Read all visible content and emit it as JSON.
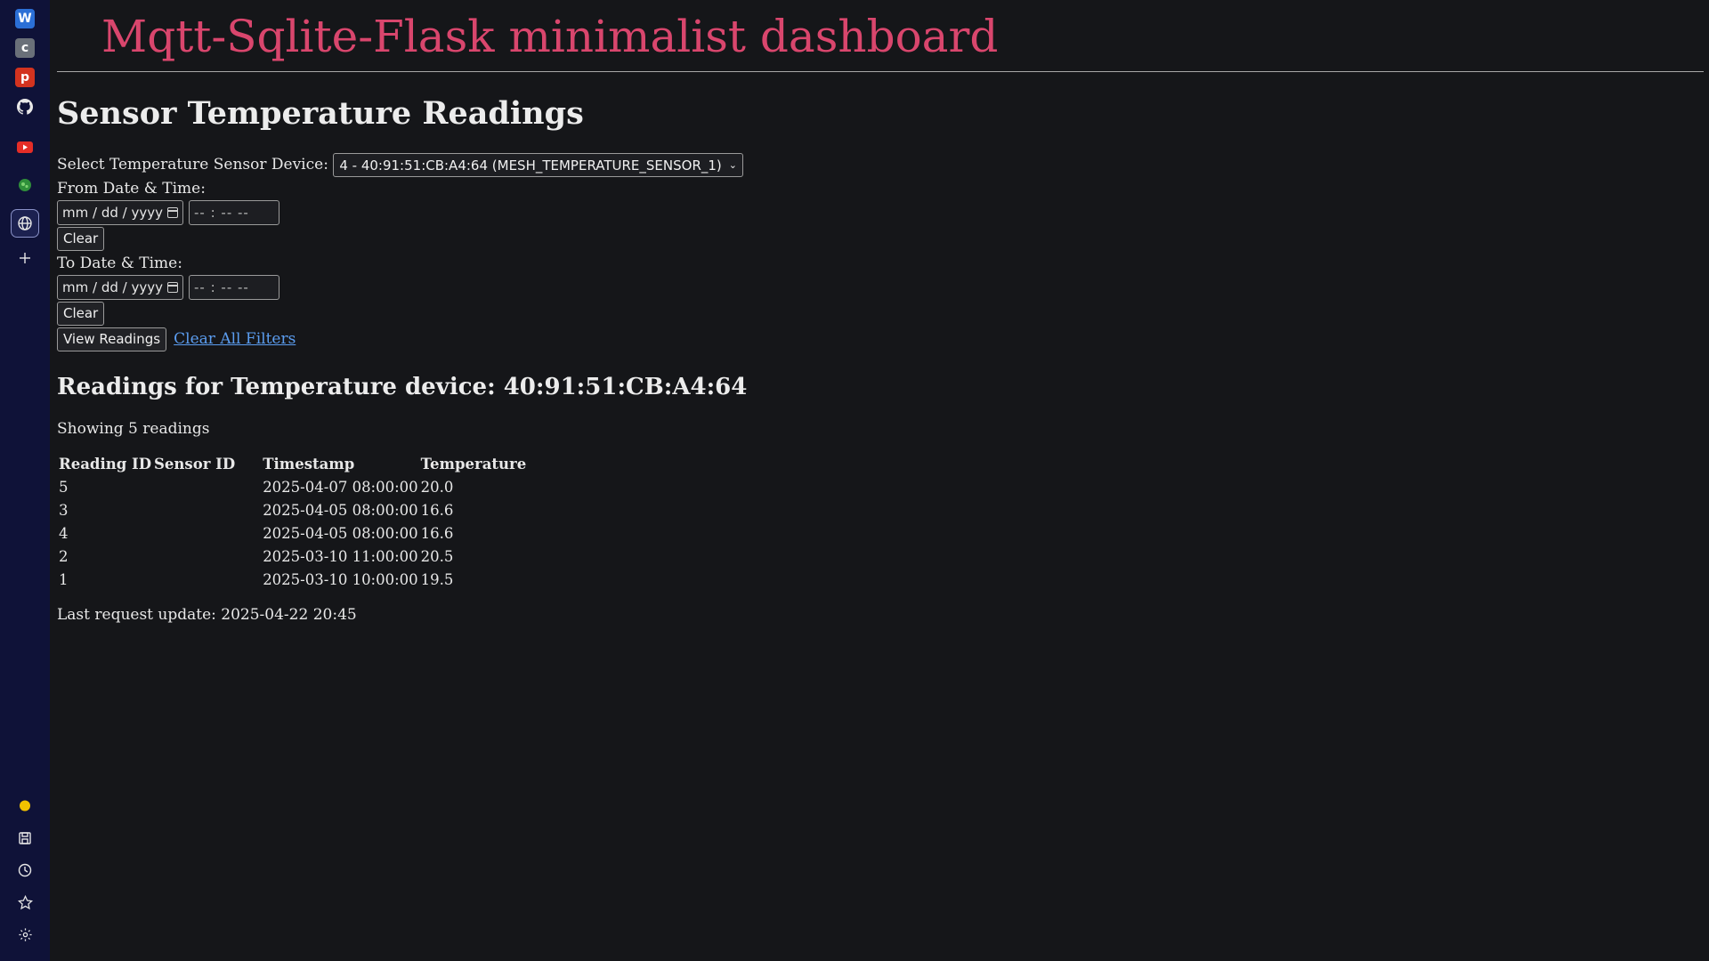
{
  "sidebar": {
    "top_icons": [
      {
        "name": "w-app-icon",
        "letter": "W",
        "color": "#2b6fd6"
      },
      {
        "name": "c-app-icon",
        "letter": "c",
        "color": "#6a7079"
      },
      {
        "name": "p-app-icon",
        "letter": "p",
        "color": "#d3331f"
      },
      {
        "name": "github-icon"
      },
      {
        "name": "youtube-icon"
      },
      {
        "name": "extension-icon"
      },
      {
        "name": "globe-icon"
      },
      {
        "name": "add-icon"
      }
    ],
    "bottom_icons": [
      "chat-icon",
      "save-page-icon",
      "history-icon",
      "favorites-icon",
      "settings-icon"
    ]
  },
  "header": {
    "title": "Mqtt-Sqlite-Flask minimalist dashboard"
  },
  "section": {
    "title": "Sensor Temperature Readings"
  },
  "form": {
    "device_label": "Select Temperature Sensor Device:",
    "device_selected": "4 - 40:91:51:CB:A4:64 (MESH_TEMPERATURE_SENSOR_1)",
    "from_label": "From Date & Time:",
    "to_label": "To Date & Time:",
    "date_placeholder": "mm / dd / yyyy",
    "time_placeholder": "-- : --  --",
    "clear_label": "Clear",
    "view_label": "View Readings",
    "clear_all_label": "Clear All Filters"
  },
  "readings": {
    "title": "Readings for Temperature device: 40:91:51:CB:A4:64",
    "count_text": "Showing 5 readings",
    "columns": [
      "Reading ID",
      "Sensor ID",
      "Timestamp",
      "Temperature"
    ],
    "rows": [
      {
        "reading_id": "5",
        "sensor_id": "",
        "timestamp": "2025-04-07 08:00:00",
        "temperature": "20.0"
      },
      {
        "reading_id": "3",
        "sensor_id": "",
        "timestamp": "2025-04-05 08:00:00",
        "temperature": "16.6"
      },
      {
        "reading_id": "4",
        "sensor_id": "",
        "timestamp": "2025-04-05 08:00:00",
        "temperature": "16.6"
      },
      {
        "reading_id": "2",
        "sensor_id": "",
        "timestamp": "2025-03-10 11:00:00",
        "temperature": "20.5"
      },
      {
        "reading_id": "1",
        "sensor_id": "",
        "timestamp": "2025-03-10 10:00:00",
        "temperature": "19.5"
      }
    ],
    "last_update": "Last request update: 2025-04-22 20:45"
  }
}
